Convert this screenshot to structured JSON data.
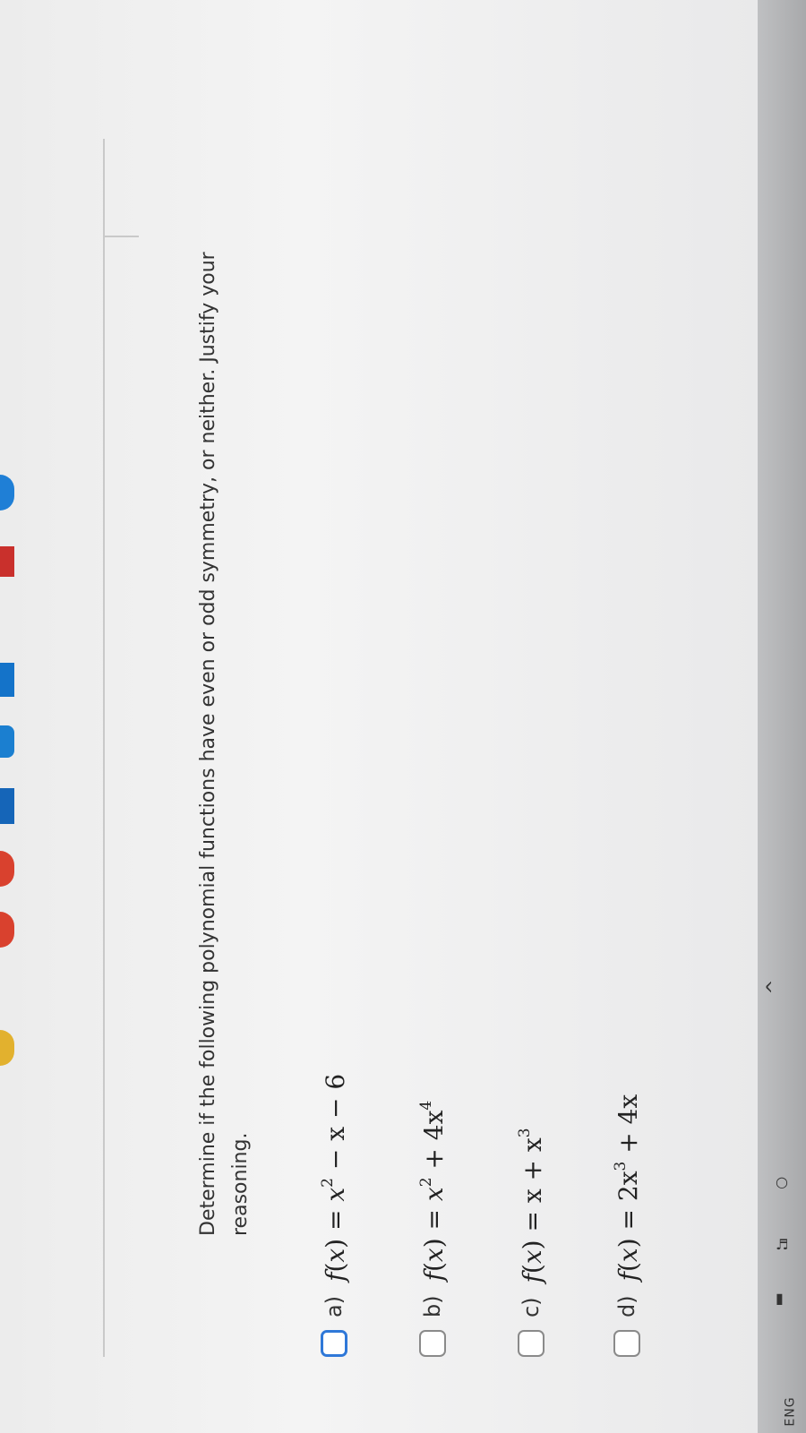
{
  "question": {
    "prompt": "Determine if the following polynomial functions have even or odd symmetry, or neither. Justify your reasoning."
  },
  "options": [
    {
      "label": "a)",
      "lhs": "f",
      "arg": "x",
      "terms": [
        [
          "x",
          "2"
        ],
        [
          " − x − 6",
          ""
        ]
      ]
    },
    {
      "label": "b)",
      "lhs": "f",
      "arg": "x",
      "terms": [
        [
          "x",
          "2"
        ],
        [
          " + 4x",
          "4"
        ]
      ]
    },
    {
      "label": "c)",
      "lhs": "f",
      "arg": "x",
      "terms": [
        [
          "x + x",
          "3"
        ]
      ]
    },
    {
      "label": "d)",
      "lhs": "f",
      "arg": "x",
      "terms": [
        [
          "2x",
          "3"
        ],
        [
          " + 4x",
          ""
        ]
      ]
    }
  ],
  "taskbar": {
    "chevron": "^",
    "language": "ENG"
  },
  "colors": {
    "focus_border": "#2f78d8",
    "checkbox_border": "#8a8a8a",
    "text": "#333333"
  }
}
